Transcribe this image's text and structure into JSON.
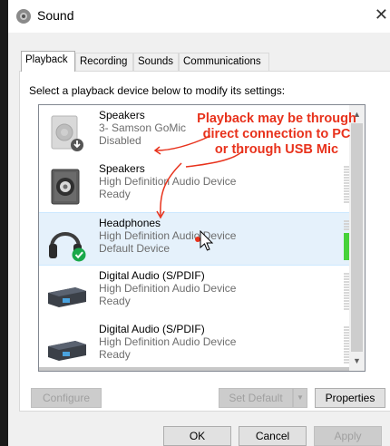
{
  "window": {
    "title": "Sound",
    "close_glyph": "✕"
  },
  "tabs": [
    {
      "label": "Playback",
      "active": true
    },
    {
      "label": "Recording",
      "active": false
    },
    {
      "label": "Sounds",
      "active": false
    },
    {
      "label": "Communications",
      "active": false
    }
  ],
  "instruction": "Select a playback device below to modify its settings:",
  "devices": [
    {
      "name": "Speakers",
      "description": "3- Samson GoMic",
      "state": "Disabled",
      "icon": "speaker-disabled-icon",
      "selected": false
    },
    {
      "name": "Speakers",
      "description": "High Definition Audio Device",
      "state": "Ready",
      "icon": "speaker-icon",
      "selected": false,
      "level": 0
    },
    {
      "name": "Headphones",
      "description": "High Definition Audio Device",
      "state": "Default Device",
      "icon": "headphones-default-icon",
      "selected": true,
      "level": 0.8
    },
    {
      "name": "Digital Audio (S/PDIF)",
      "description": "High Definition Audio Device",
      "state": "Ready",
      "icon": "spdif-device-icon",
      "selected": false,
      "level": 0
    },
    {
      "name": "Digital Audio (S/PDIF)",
      "description": "High Definition Audio Device",
      "state": "Ready",
      "icon": "spdif-device-icon",
      "selected": false,
      "level": 0
    }
  ],
  "annotation": {
    "line1": "Playback may be through",
    "line2": "direct connection to PC",
    "line3": "or through USB Mic",
    "color": "#e8321c"
  },
  "buttons": {
    "configure": "Configure",
    "set_default": "Set Default",
    "properties": "Properties",
    "ok": "OK",
    "cancel": "Cancel",
    "apply": "Apply"
  },
  "colors": {
    "selected_row": "#e5f1fb",
    "level_meter": "#46d23a"
  }
}
